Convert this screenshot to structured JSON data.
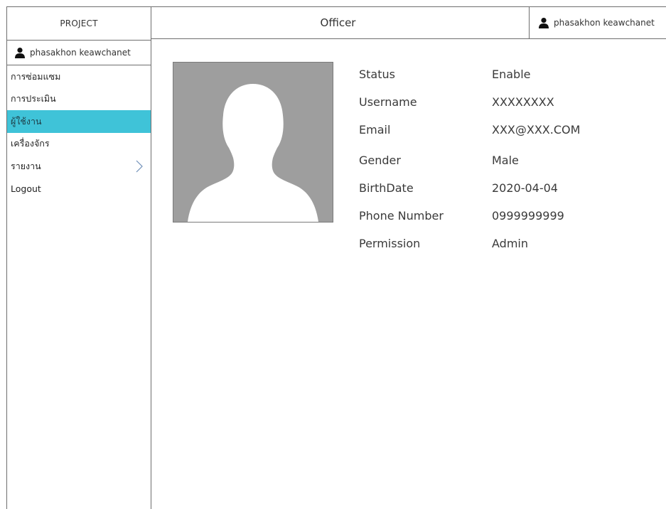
{
  "app": {
    "brand": "PROJECT"
  },
  "user": {
    "name": "phasakhon keawchanet"
  },
  "header": {
    "title": "Officer"
  },
  "menu": [
    {
      "label": "การซ่อมแซม"
    },
    {
      "label": "การประเมิน"
    },
    {
      "label": "ผู้ใช้งาน",
      "active": true
    },
    {
      "label": "เครื่องจักร"
    },
    {
      "label": "รายงาน",
      "has_submenu": true
    },
    {
      "label": "Logout"
    }
  ],
  "colors": {
    "active_menu": "#3fc3d8",
    "avatar_bg": "#9e9e9e",
    "border": "#6e6e6e"
  },
  "profile": {
    "status_label": "Status",
    "status_value": "Enable",
    "username_label": "Username",
    "username_value": "XXXXXXXX",
    "email_label": "Email",
    "email_value": "XXX@XXX.COM",
    "gender_label": "Gender",
    "gender_value": "Male",
    "birthdate_label": "BirthDate",
    "birthdate_value": "2020-04-04",
    "phone_label": "Phone Number",
    "phone_value": "0999999999",
    "permission_label": "Permission",
    "permission_value": "Admin"
  }
}
